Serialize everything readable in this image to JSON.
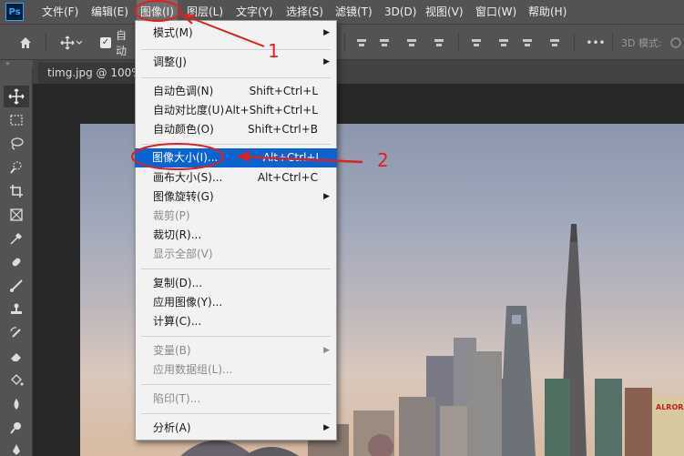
{
  "app": {
    "logo": "Ps"
  },
  "menubar": {
    "items": [
      {
        "label": "文件(F)"
      },
      {
        "label": "编辑(E)"
      },
      {
        "label": "图像(I)"
      },
      {
        "label": "图层(L)"
      },
      {
        "label": "文字(Y)"
      },
      {
        "label": "选择(S)"
      },
      {
        "label": "滤镜(T)"
      },
      {
        "label": "3D(D)"
      },
      {
        "label": "视图(V)"
      },
      {
        "label": "窗口(W)"
      },
      {
        "label": "帮助(H)"
      }
    ]
  },
  "options_bar": {
    "auto_select_label": "自动",
    "mode_3d_label": "3D 模式:",
    "more": "•••"
  },
  "document": {
    "tab_title": "timg.jpg @ 100%("
  },
  "image_menu": {
    "items": [
      {
        "label": "模式(M)",
        "shortcut": "",
        "submenu": true
      },
      {
        "label": "调整(J)",
        "shortcut": "",
        "submenu": true
      },
      {
        "label": "自动色调(N)",
        "shortcut": "Shift+Ctrl+L"
      },
      {
        "label": "自动对比度(U)",
        "shortcut": "Alt+Shift+Ctrl+L"
      },
      {
        "label": "自动颜色(O)",
        "shortcut": "Shift+Ctrl+B"
      },
      {
        "label": "图像大小(I)...",
        "shortcut": "Alt+Ctrl+I"
      },
      {
        "label": "画布大小(S)...",
        "shortcut": "Alt+Ctrl+C"
      },
      {
        "label": "图像旋转(G)",
        "shortcut": "",
        "submenu": true
      },
      {
        "label": "裁剪(P)",
        "shortcut": "",
        "disabled": true
      },
      {
        "label": "裁切(R)...",
        "shortcut": ""
      },
      {
        "label": "显示全部(V)",
        "shortcut": "",
        "disabled": true
      },
      {
        "label": "复制(D)...",
        "shortcut": ""
      },
      {
        "label": "应用图像(Y)...",
        "shortcut": ""
      },
      {
        "label": "计算(C)...",
        "shortcut": ""
      },
      {
        "label": "变量(B)",
        "shortcut": "",
        "submenu": true,
        "disabled": true
      },
      {
        "label": "应用数据组(L)...",
        "shortcut": "",
        "disabled": true
      },
      {
        "label": "陷印(T)...",
        "shortcut": "",
        "disabled": true
      },
      {
        "label": "分析(A)",
        "shortcut": "",
        "submenu": true
      }
    ]
  },
  "annotations": {
    "step1": "1",
    "step2": "2"
  },
  "photo": {
    "sign_text": "ALRORA"
  },
  "colors": {
    "highlight": "#0a64d0",
    "annotation": "#e02020",
    "ps_blue": "#31a8ff"
  }
}
